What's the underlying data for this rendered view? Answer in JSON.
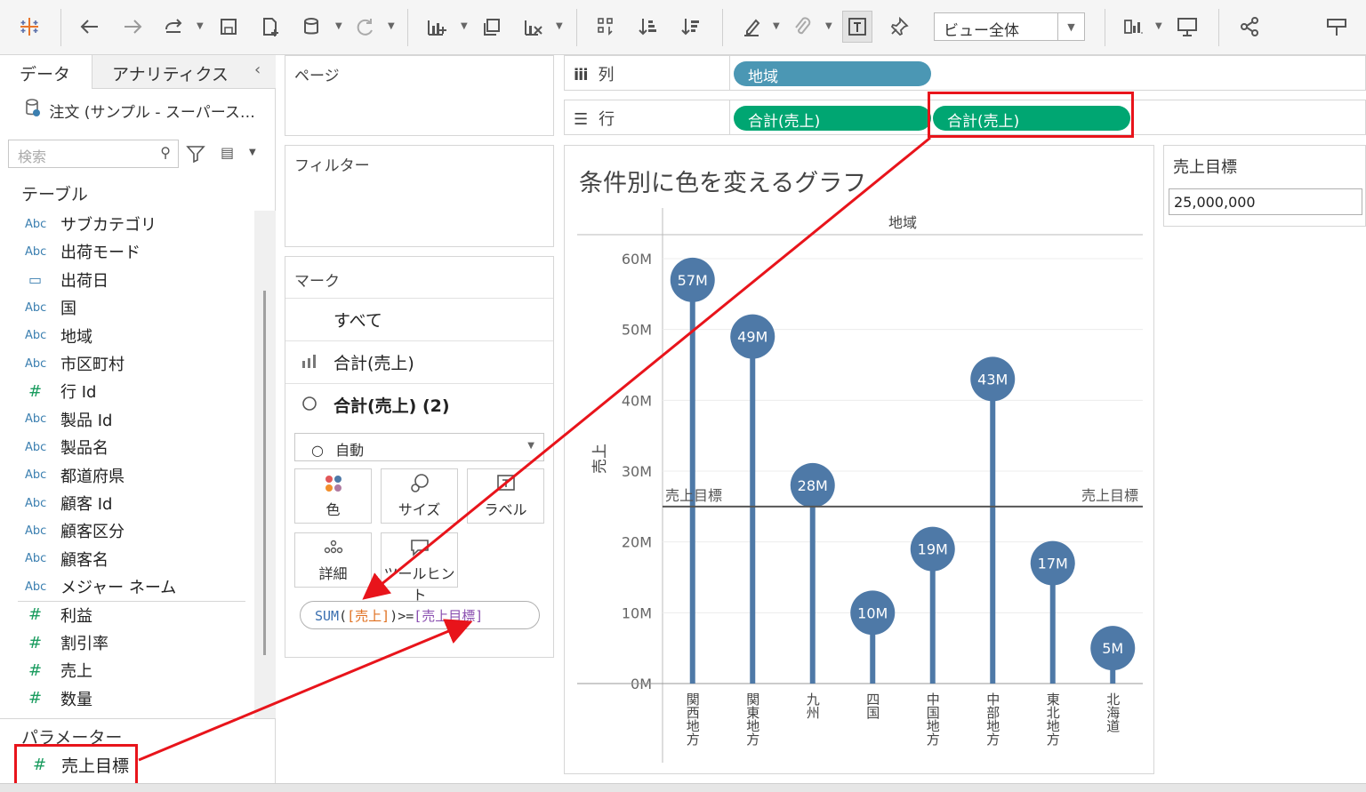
{
  "toolbar": {
    "view_select": "ビュー全体",
    "icons": [
      "tableau-logo-icon",
      "undo-icon",
      "redo-icon",
      "replay-icon",
      "save-icon",
      "new-datasource-icon",
      "datasource-icon",
      "refresh-icon",
      "new-sheet-icon",
      "duplicate-sheet-icon",
      "clear-sheet-icon",
      "swap-icon",
      "sort-ascending-icon",
      "sort-descending-icon",
      "highlight-icon",
      "group-icon",
      "show-labels-icon",
      "pin-icon",
      "show-me-icon",
      "presentation-icon",
      "share-icon",
      "show-me-right-icon"
    ]
  },
  "sidebar": {
    "tabs": [
      "データ",
      "アナリティクス"
    ],
    "datasource": "注文 (サンプル - スーパース…",
    "search_placeholder": "検索",
    "section_tables": "テーブル",
    "fields": [
      {
        "type": "Abc",
        "name": "サブカテゴリ"
      },
      {
        "type": "Abc",
        "name": "出荷モード"
      },
      {
        "type": "date",
        "name": "出荷日"
      },
      {
        "type": "Abc",
        "name": "国"
      },
      {
        "type": "Abc",
        "name": "地域"
      },
      {
        "type": "Abc",
        "name": "市区町村"
      },
      {
        "type": "#",
        "name": "行 Id"
      },
      {
        "type": "Abc",
        "name": "製品 Id"
      },
      {
        "type": "Abc",
        "name": "製品名"
      },
      {
        "type": "Abc",
        "name": "都道府県"
      },
      {
        "type": "Abc",
        "name": "顧客 Id"
      },
      {
        "type": "Abc",
        "name": "顧客区分"
      },
      {
        "type": "Abc",
        "name": "顧客名"
      },
      {
        "type": "Abc",
        "name": "メジャー ネーム"
      },
      {
        "type": "#",
        "name": "利益"
      },
      {
        "type": "#",
        "name": "割引率"
      },
      {
        "type": "#",
        "name": "売上"
      },
      {
        "type": "#",
        "name": "数量"
      }
    ],
    "section_params": "パラメーター",
    "param": {
      "type": "#",
      "name": "売上目標"
    }
  },
  "cards": {
    "pages": "ページ",
    "filters": "フィルター",
    "marks": {
      "title": "マーク",
      "rows": [
        "すべて",
        "合計(売上)",
        "合計(売上) (2)"
      ],
      "mark_type": "自動",
      "buttons": [
        "色",
        "サイズ",
        "ラベル",
        "詳細",
        "ツールヒント"
      ],
      "calc": {
        "fn": "SUM",
        "open": "(",
        "field": "[売上]",
        "close": ")",
        "op": ">=",
        "param": "[売上目標]"
      }
    }
  },
  "shelves": {
    "columns_label": "列",
    "rows_label": "行",
    "columns_pill": "地域",
    "rows_pills": [
      "合計(売上)",
      "合計(売上)"
    ]
  },
  "param_card": {
    "title": "売上目標",
    "value": "25,000,000"
  },
  "chart_data": {
    "type": "bar",
    "title": "条件別に色を変えるグラフ",
    "header": "地域",
    "ylabel": "売上",
    "ylim": [
      0,
      60000000
    ],
    "yticks": [
      "0M",
      "10M",
      "20M",
      "30M",
      "40M",
      "50M",
      "60M"
    ],
    "categories": [
      "関西地方",
      "関東地方",
      "九州",
      "四国",
      "中国地方",
      "中部地方",
      "東北地方",
      "北海道"
    ],
    "values": [
      57000000,
      49000000,
      28000000,
      10000000,
      19000000,
      43000000,
      17000000,
      5000000
    ],
    "labels": [
      "57M",
      "49M",
      "28M",
      "10M",
      "19M",
      "43M",
      "17M",
      "5M"
    ],
    "reference_line": {
      "value": 25000000,
      "label": "売上目標"
    },
    "color": "#4e79a7"
  }
}
